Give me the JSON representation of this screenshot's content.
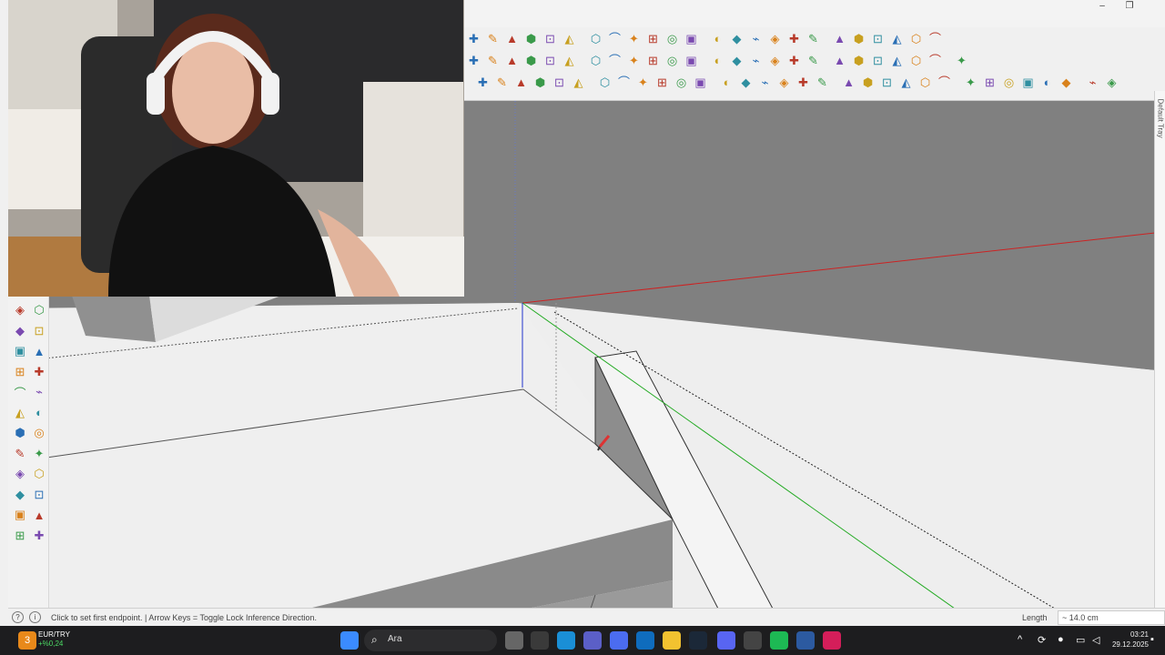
{
  "window": {
    "minimize": "–",
    "restore": "❐"
  },
  "toolbar": {
    "row1_icons": [
      "styles-icon",
      "x-ray-icon",
      "account-icon",
      "new-file-icon",
      "user-icon",
      "sandbox-icon",
      "smoove-icon",
      "add-detail-icon",
      "flip-edge-icon",
      "drape-icon",
      "stamp-icon",
      "from-contours-icon",
      "scenes-icon",
      "section-icon",
      "section-fill-icon",
      "section-plane-icon",
      "display-section-icon",
      "display-cuts-icon",
      "iso-icon",
      "top-icon",
      "front-icon",
      "right-icon",
      "back-icon",
      "left-icon"
    ],
    "row2_icons": [
      "warning-icon",
      "follow-me-icon",
      "paint-icon",
      "orbit-icon",
      "move-icon",
      "push-pull-icon",
      "undo-icon",
      "component-icon",
      "solid-union-icon",
      "solid-subtract-icon",
      "solid-trim-icon",
      "solid-split-icon",
      "grid-icon",
      "grid2-icon",
      "box-icon",
      "box2-icon",
      "box3-icon",
      "close-x-icon",
      "curve-icon",
      "joint-icon",
      "intersect-icon",
      "split-icon",
      "bezier-icon",
      "corner-icon",
      "frame-icon"
    ],
    "row3_icons": [
      "freehand-icon",
      "arc-icon",
      "eraser-icon",
      "zigzag-icon",
      "pencil-icon",
      "arc2-icon",
      "rect-icon",
      "circle-icon",
      "arc3-icon",
      "wave-icon",
      "curve2-icon",
      "arc4-icon",
      "arc5-icon",
      "arc6-icon",
      "spiral-icon",
      "polygon-icon",
      "cone-icon",
      "pin-icon",
      "circle2-icon",
      "shape-icon",
      "view1-icon",
      "view2-icon",
      "view3-icon",
      "view4-icon",
      "view5-icon",
      "view6-icon",
      "view7-icon",
      "view8-icon",
      "view9-icon",
      "view10-icon",
      "view11-icon",
      "view12-icon"
    ]
  },
  "left_toolbar": {
    "icons": [
      "select-icon",
      "freehand-draw-icon",
      "smart-icon",
      "paint-bucket-icon",
      "move-icon",
      "rotate-icon",
      "pencil-icon",
      "text-icon",
      "orbit-icon",
      "dimension-icon",
      "tape-icon",
      "pan-icon",
      "zoom-icon",
      "zoom-window-icon",
      "zoom-extents-icon",
      "previous-icon",
      "walk-icon",
      "position-camera-icon",
      "look-around-icon",
      "section-icon",
      "layers-icon",
      "scenes-icon",
      "styles-icon",
      "shadows-icon"
    ]
  },
  "tray": {
    "label": "Default Tray"
  },
  "status": {
    "message": "Click to set first endpoint. | Arrow Keys = Toggle Lock Inference Direction.",
    "length_label": "Length",
    "length_value": "~ 14.0 cm"
  },
  "taskbar": {
    "ticker_symbol": "EUR/TRY",
    "ticker_change": "+%0,24",
    "ticker_badge": "3",
    "search_placeholder": "Ara",
    "time": "03:21",
    "date": "29.12.2025",
    "apps": [
      "windows-start-icon",
      "search-icon",
      "task-view-icon",
      "store-icon",
      "edge-icon",
      "teams-icon",
      "copilot-icon",
      "outlook-icon",
      "file-explorer-icon",
      "steam-icon",
      "discord-icon",
      "obs-icon",
      "spotify-icon",
      "sketchup-icon",
      "adobe-icon"
    ]
  },
  "colors": {
    "axis_red": "#cc2222",
    "axis_green": "#22aa22",
    "axis_blue": "#2233cc",
    "sky": "#808080",
    "ground": "#efefef",
    "taskbar": "#1d1d1f"
  }
}
